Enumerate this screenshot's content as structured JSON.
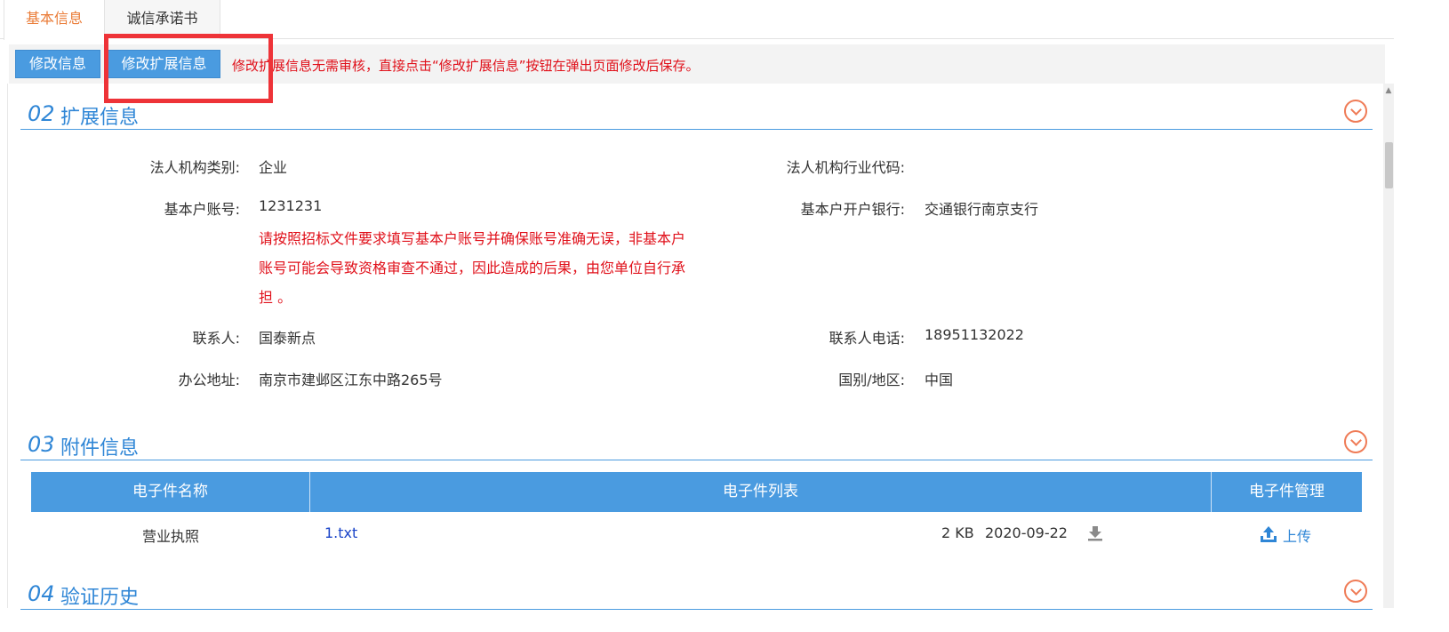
{
  "tabs": [
    {
      "label": "基本信息",
      "active": true
    },
    {
      "label": "诚信承诺书",
      "active": false
    }
  ],
  "toolbar": {
    "edit_info_label": "修改信息",
    "edit_ext_label": "修改扩展信息",
    "note": "修改扩展信息无需审核，直接点击“修改扩展信息”按钮在弹出页面修改后保存。"
  },
  "sections": {
    "ext": {
      "num": "02",
      "title": "扩展信息"
    },
    "attach": {
      "num": "03",
      "title": "附件信息"
    },
    "history": {
      "num": "04",
      "title": "验证历史"
    }
  },
  "fields": {
    "org_type_label": "法人机构类别:",
    "org_type_value": "企业",
    "industry_code_label": "法人机构行业代码:",
    "industry_code_value": "",
    "account_label": "基本户账号:",
    "account_value": "1231231",
    "account_warning": "请按照招标文件要求填写基本户账号并确保账号准确无误，非基本户账号可能会导致资格审查不通过，因此造成的后果，由您单位自行承担 。",
    "bank_label": "基本户开户银行:",
    "bank_value": "交通银行南京支行",
    "contact_label": "联系人:",
    "contact_value": "国泰新点",
    "phone_label": "联系人电话:",
    "phone_value": "18951132022",
    "address_label": "办公地址:",
    "address_value": "南京市建邺区江东中路265号",
    "region_label": "国别/地区:",
    "region_value": "中国"
  },
  "attachments": {
    "headers": [
      "电子件名称",
      "电子件列表",
      "电子件管理"
    ],
    "rows": [
      {
        "name": "营业执照",
        "file": "1.txt",
        "size": "2 KB",
        "date": "2020-09-22",
        "action": "上传"
      }
    ]
  },
  "colors": {
    "accent": "#4a9be0",
    "warning": "#e0101a",
    "active_tab": "#ea7b36",
    "highlight": "#ee3338"
  },
  "icons": [
    "chevron-down-circle-icon",
    "download-icon",
    "upload-icon"
  ]
}
